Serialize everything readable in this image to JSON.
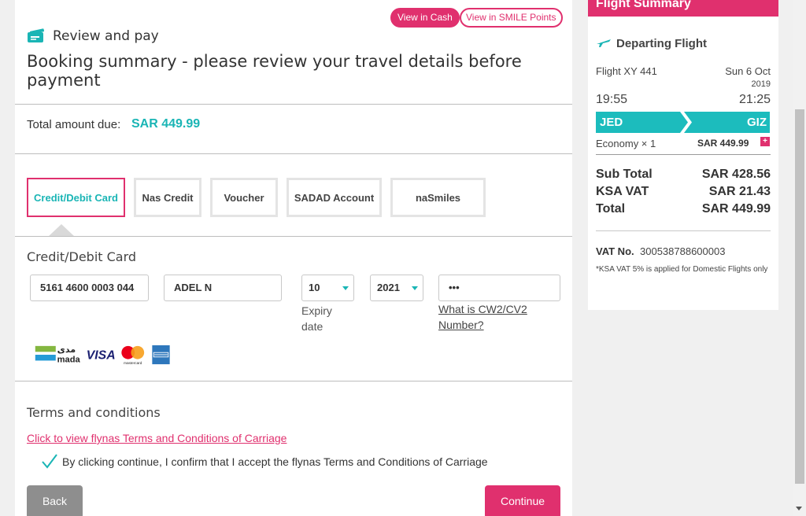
{
  "header": {
    "view_cash": "View in Cash",
    "view_smile": "View in SMILE Points",
    "review_pay": "Review and pay",
    "booking_title": "Booking summary - please review your travel details before payment"
  },
  "total": {
    "label": "Total amount due:",
    "value": "SAR 449.99"
  },
  "payment_tabs": [
    "Credit/Debit Card",
    "Nas Credit",
    "Voucher",
    "SADAD Account",
    "naSmiles"
  ],
  "card": {
    "heading": "Credit/Debit Card",
    "number_value": "5161 4600 0003 044",
    "name_value": "ADEL N",
    "expiry_month": "10",
    "expiry_year": "2021",
    "expiry_label": "Expiry date",
    "cvv_value": "•••",
    "cvv_link": "What is CW2/CV2 Number?",
    "brands": [
      "mada",
      "VISA",
      "mastercard",
      "American Express"
    ]
  },
  "terms": {
    "heading": "Terms and conditions",
    "link": "Click to view flynas Terms and Conditions of Carriage",
    "consent": "By clicking continue, I confirm that I accept the flynas Terms and Conditions of Carriage"
  },
  "buttons": {
    "back": "Back",
    "continue": "Continue"
  },
  "summary": {
    "title": "Flight Summary",
    "departing": "Departing Flight",
    "flight_no": "Flight XY 441",
    "date": "Sun 6 Oct",
    "year": "2019",
    "dep_time": "19:55",
    "arr_time": "21:25",
    "origin": "JED",
    "destination": "GIZ",
    "fare_class": "Economy × 1",
    "fare_price": "SAR 449.99",
    "plus": "+",
    "subtotal_label": "Sub Total",
    "subtotal_value": "SAR 428.56",
    "vat_label": "KSA VAT",
    "vat_value": "SAR 21.43",
    "grand_label": "Total",
    "grand_value": "SAR 449.99",
    "vat_no_label": "VAT No.",
    "vat_no_value": "300538788600003",
    "vat_note": "*KSA VAT 5% is applied for Domestic Flights only"
  },
  "colors": {
    "brand_pink": "#e0306e",
    "accent_teal": "#1ab5b5"
  },
  "icons": [
    "ticket-icon",
    "plane-icon",
    "check-icon",
    "chevron-down-icon"
  ]
}
